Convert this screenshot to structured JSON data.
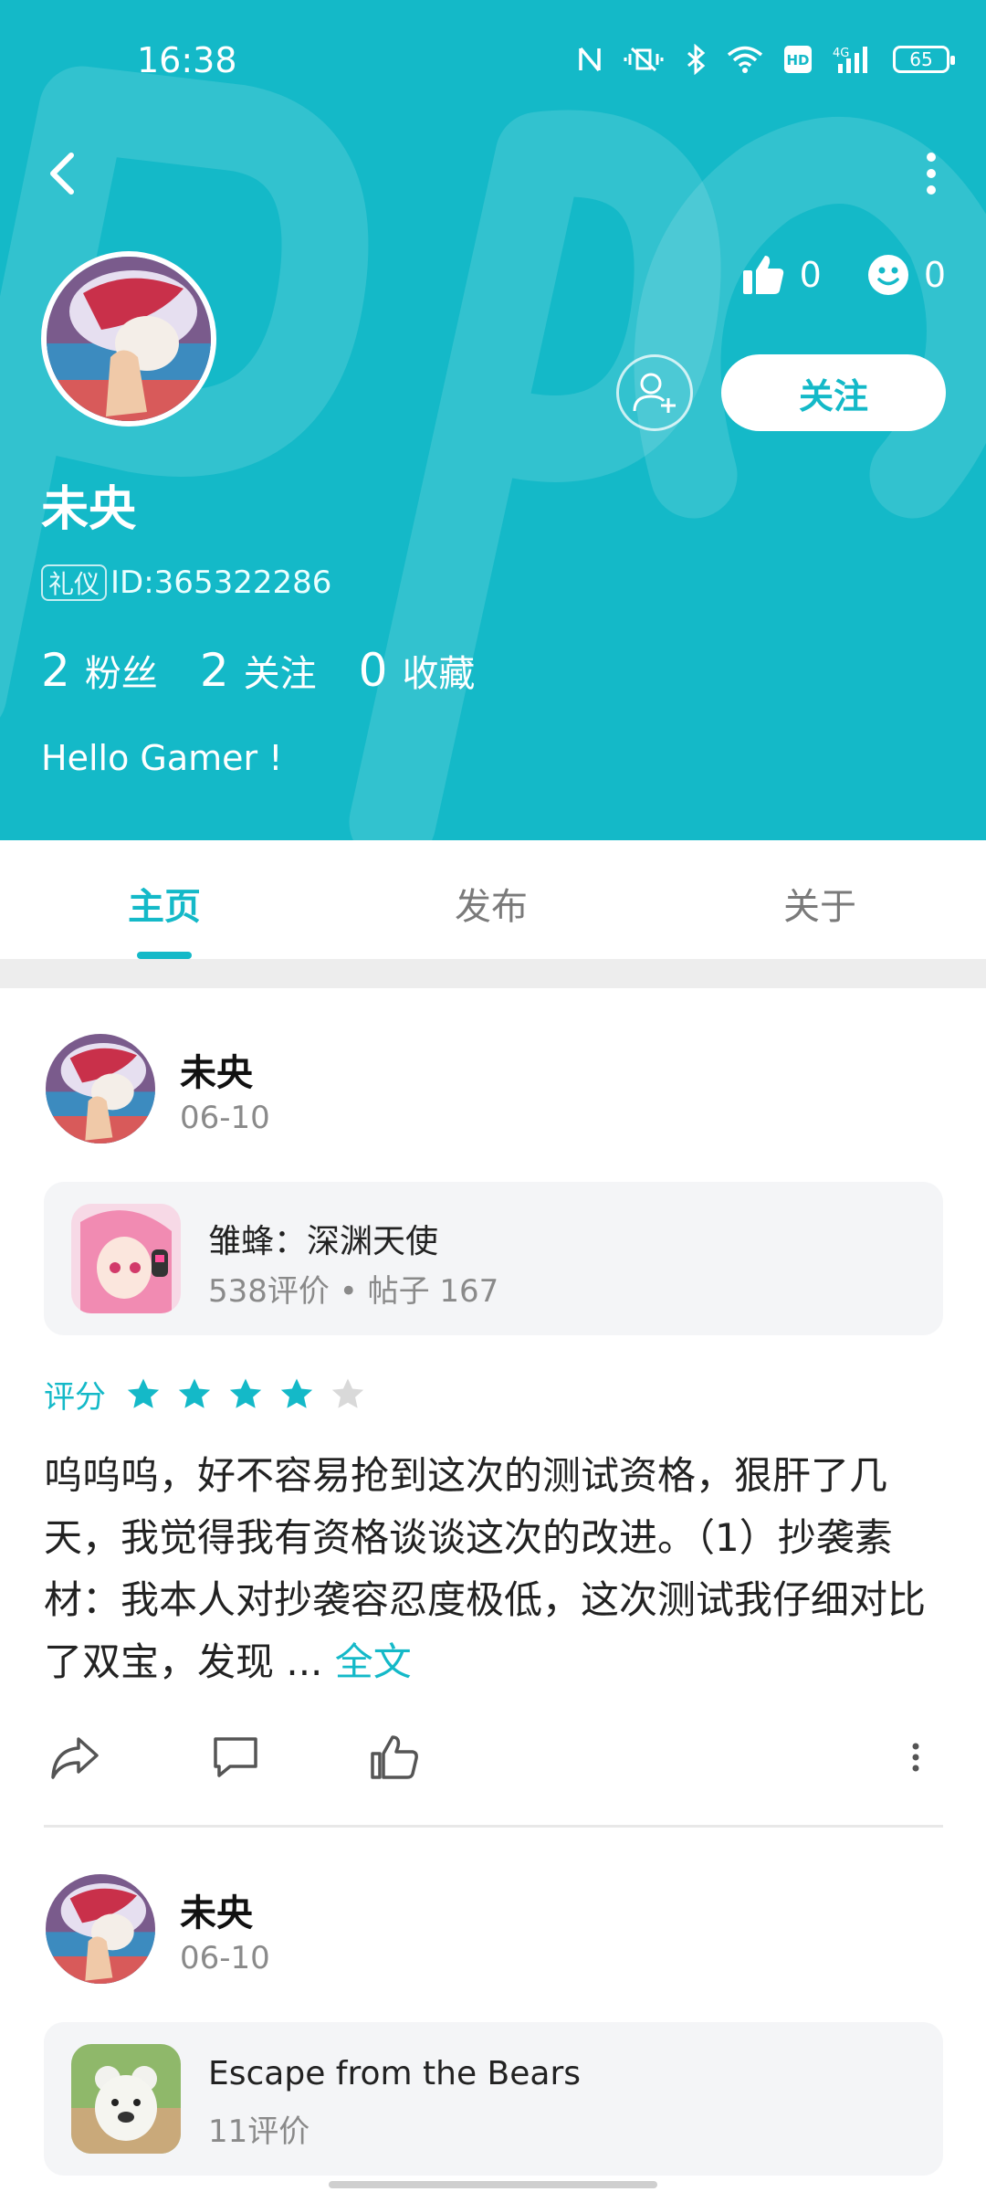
{
  "status_bar": {
    "time": "16:38",
    "battery": "65"
  },
  "profile": {
    "name": "未央",
    "id_badge": "礼仪",
    "id_text": "ID:365322286",
    "likes": "0",
    "smiles": "0",
    "follow_label": "关注",
    "bio": "Hello Gamer !",
    "counts": [
      {
        "num": "2",
        "label": "粉丝"
      },
      {
        "num": "2",
        "label": "关注"
      },
      {
        "num": "0",
        "label": "收藏"
      }
    ]
  },
  "tabs": [
    {
      "label": "主页"
    },
    {
      "label": "发布"
    },
    {
      "label": "关于"
    }
  ],
  "posts": [
    {
      "author": "未央",
      "date": "06-10",
      "game_name": "雏蜂：深渊天使",
      "game_meta": "538评价 • 帖子 167",
      "rating_label": "评分",
      "rating": 4,
      "text": "呜呜呜，好不容易抢到这次的测试资格，狠肝了几天，我觉得我有资格谈谈这次的改进。（1）抄袭素材：我本人对抄袭容忍度极低，这次测试我仔细对比了双宝，发现 ... ",
      "full_link": "全文"
    },
    {
      "author": "未央",
      "date": "06-10",
      "game_name": "Escape from the Bears",
      "game_meta": "11评价"
    }
  ],
  "colors": {
    "accent": "#14b9c8",
    "star_off": "#d9d9d9"
  }
}
